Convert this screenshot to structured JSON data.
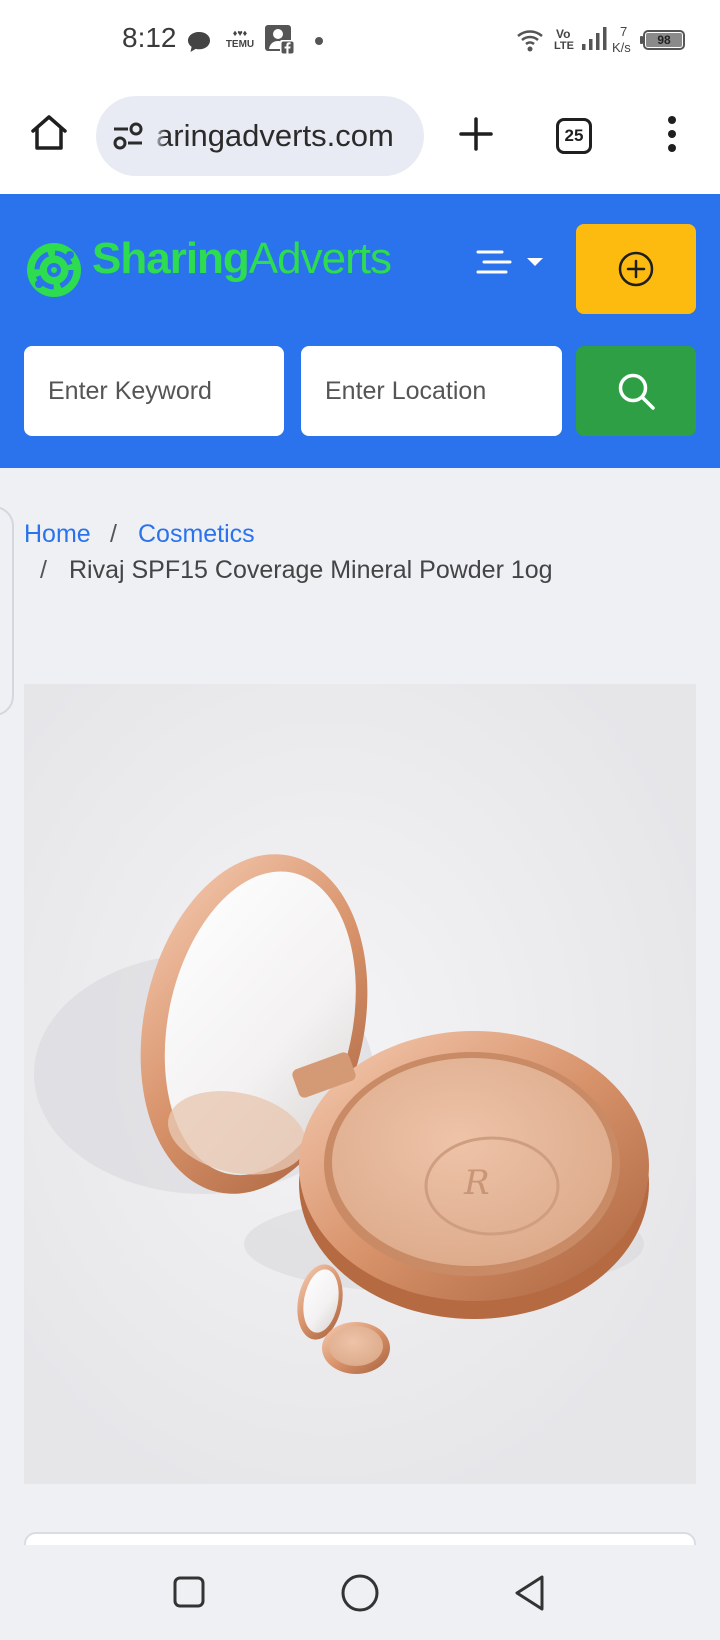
{
  "status_bar": {
    "time": "8:12",
    "temu_label": "TEMU",
    "network_vo": "Vo",
    "network_lte": "LTE",
    "speed_value": "7",
    "speed_unit": "K/s",
    "battery": "98",
    "icons": [
      "chat-icon",
      "temu-icon",
      "facebook-icon",
      "dot-icon",
      "wifi-icon",
      "signal-icon",
      "battery-icon"
    ]
  },
  "browser": {
    "url": "aringadverts.com",
    "tab_count": "25",
    "icons": [
      "home-icon",
      "site-settings-icon",
      "new-tab-icon",
      "tabs-icon",
      "more-menu-icon"
    ]
  },
  "site": {
    "logo_part1": "Sharing",
    "logo_part2": "Adverts",
    "keyword_placeholder": "Enter Keyword",
    "location_placeholder": "Enter Location",
    "colors": {
      "header": "#2b73ec",
      "logo": "#2ddc4f",
      "post_button": "#fdba0f",
      "search_button": "#2e9f45"
    }
  },
  "breadcrumb": {
    "home": "Home",
    "separator": "/",
    "category": "Cosmetics",
    "current": "Rivaj SPF15 Coverage Mineral Powder 1og"
  },
  "product": {
    "image_icon": "compact-powder-image"
  },
  "nav": {
    "icons": [
      "recents-icon",
      "home-circle-icon",
      "back-icon"
    ]
  }
}
